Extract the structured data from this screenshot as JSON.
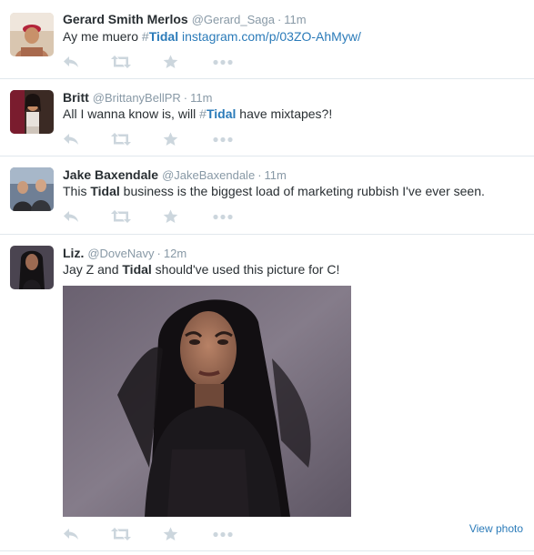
{
  "tweets": [
    {
      "fullname": "Gerard Smith Merlos",
      "handle": "@Gerard_Saga",
      "separator": "·",
      "time": "11m",
      "parts": [
        "Ay me muero ",
        "#",
        "Tidal",
        " ",
        "instagram.com/p/03ZO-AhMyw/"
      ]
    },
    {
      "fullname": "Britt",
      "handle": "@BrittanyBellPR",
      "separator": "·",
      "time": "11m",
      "parts": [
        "All I wanna know is, will ",
        "#",
        "Tidal",
        " have mixtapes?!"
      ]
    },
    {
      "fullname": "Jake Baxendale",
      "handle": "@JakeBaxendale",
      "separator": "·",
      "time": "11m",
      "parts": [
        "This ",
        "Tidal",
        " business is the biggest load of marketing rubbish I've ever seen."
      ]
    },
    {
      "fullname": "Liz.",
      "handle": "@DoveNavy",
      "separator": "·",
      "time": "12m",
      "parts": [
        "Jay Z and ",
        "Tidal",
        " should've used this picture for C!"
      ],
      "view_photo": "View photo"
    }
  ],
  "icons": {
    "reply": "reply-icon",
    "retweet": "retweet-icon",
    "favorite": "star-icon",
    "more": "more-icon"
  },
  "colors": {
    "action_icon": "#ccd6dd",
    "link": "#2b7bb9",
    "meta": "#8899a6",
    "text": "#292f33",
    "divider": "#e1e8ed"
  }
}
